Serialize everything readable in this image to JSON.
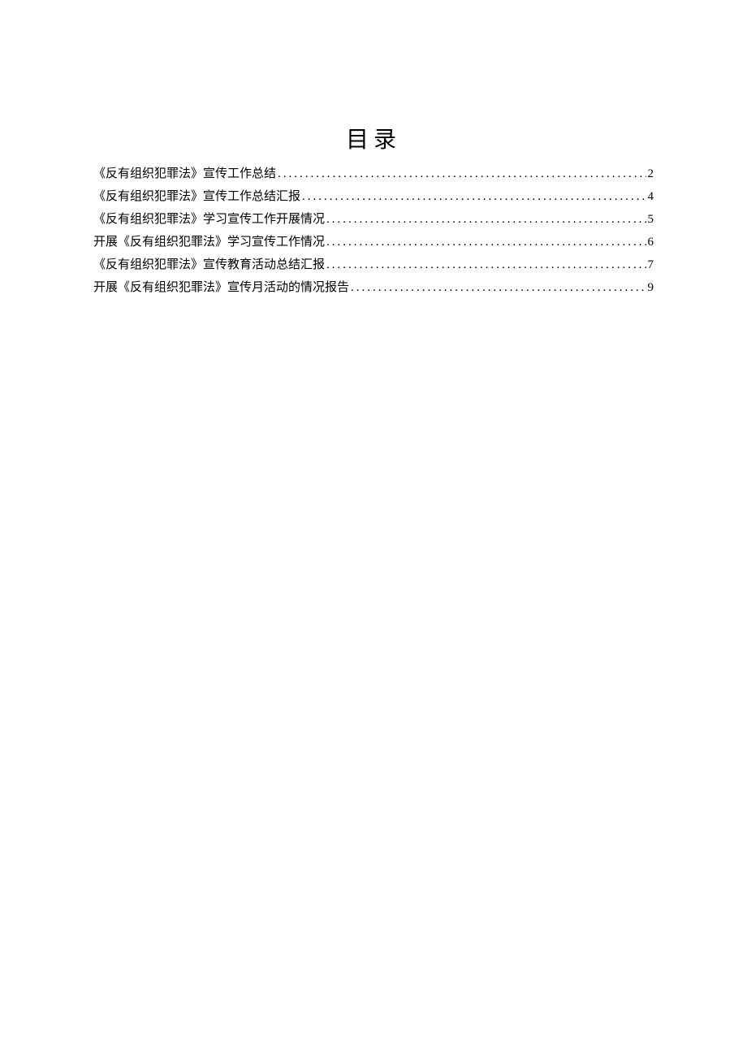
{
  "toc": {
    "title": "目录",
    "entries": [
      {
        "label": "《反有组织犯罪法》宣传工作总结",
        "page": "2"
      },
      {
        "label": "《反有组织犯罪法》宣传工作总结汇报",
        "page": "4"
      },
      {
        "label": "《反有组织犯罪法》学习宣传工作开展情况",
        "page": "5"
      },
      {
        "label": "开展《反有组织犯罪法》学习宣传工作情况",
        "page": "6"
      },
      {
        "label": "《反有组织犯罪法》宣传教育活动总结汇报",
        "page": "7"
      },
      {
        "label": "开展《反有组织犯罪法》宣传月活动的情况报告",
        "page": "9"
      }
    ]
  }
}
